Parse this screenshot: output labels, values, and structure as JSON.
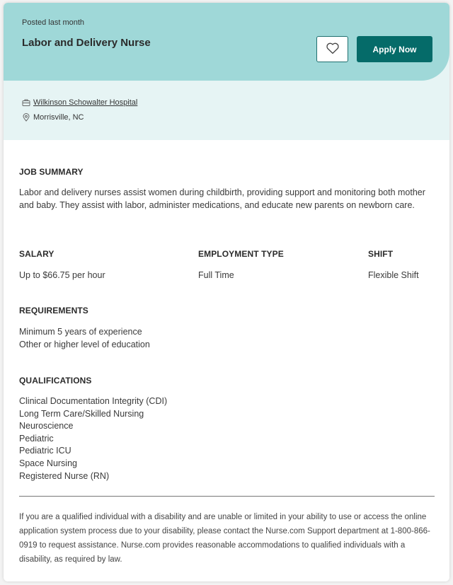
{
  "header": {
    "posted": "Posted last month",
    "title": "Labor and Delivery Nurse",
    "favorite_icon": "heart-outline-icon",
    "apply_label": "Apply Now",
    "company": "Wilkinson Schowalter Hospital",
    "company_icon": "briefcase-icon",
    "location": "Morrisville, NC",
    "location_icon": "map-pin-icon"
  },
  "colors": {
    "header_bg": "#9fd8d8",
    "subheader_bg": "#e6f4f4",
    "accent": "#056b69"
  },
  "summary": {
    "title": "JOB SUMMARY",
    "text": "Labor and delivery nurses assist women during childbirth, providing support and monitoring both mother and baby. They assist with labor, administer medications, and educate new parents on newborn care."
  },
  "details": {
    "salary": {
      "label": "SALARY",
      "value": "Up to $66.75 per hour"
    },
    "employment_type": {
      "label": "EMPLOYMENT TYPE",
      "value": "Full Time"
    },
    "shift": {
      "label": "SHIFT",
      "value": "Flexible Shift"
    }
  },
  "requirements": {
    "title": "REQUIREMENTS",
    "items": [
      "Minimum 5 years of experience",
      "Other or higher level of education"
    ]
  },
  "qualifications": {
    "title": "QUALIFICATIONS",
    "items": [
      "Clinical Documentation Integrity (CDI)",
      "Long Term Care/Skilled Nursing",
      "Neuroscience",
      "Pediatric",
      "Pediatric ICU",
      "Space Nursing",
      "Registered Nurse (RN)"
    ]
  },
  "disclaimer": "If you are a qualified individual with a disability and are unable or limited in your ability to use or access the online application system process due to your disability, please contact the Nurse.com Support department at 1-800-866-0919 to request assistance. Nurse.com provides reasonable accommodations to qualified individuals with a disability, as required by law."
}
